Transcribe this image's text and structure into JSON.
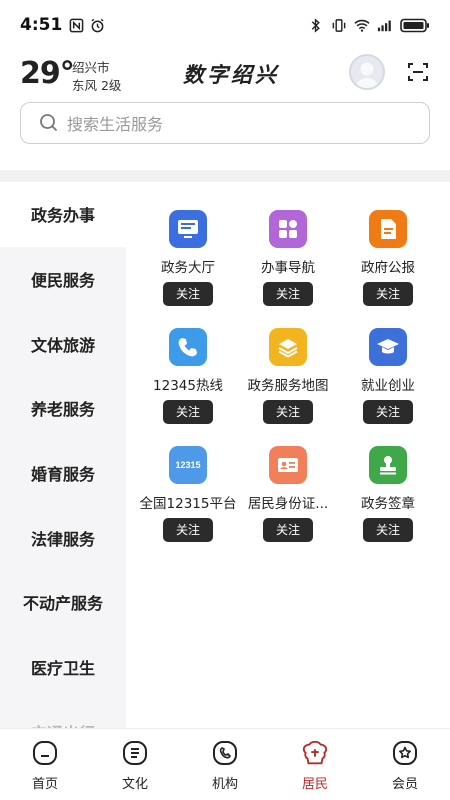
{
  "status_bar": {
    "time": "4:51",
    "icons": [
      "nfc-icon",
      "alarm-icon",
      "bluetooth-icon",
      "vibrate-icon",
      "wifi-icon",
      "signal-icon",
      "battery-icon"
    ]
  },
  "header": {
    "temperature": "29°",
    "city": "绍兴市",
    "wind": "东风 2级",
    "logo": "数字绍兴"
  },
  "search": {
    "placeholder": "搜索生活服务"
  },
  "sidebar": {
    "items": [
      {
        "label": "政务办事",
        "active": true
      },
      {
        "label": "便民服务"
      },
      {
        "label": "文体旅游"
      },
      {
        "label": "养老服务"
      },
      {
        "label": "婚育服务"
      },
      {
        "label": "法律服务"
      },
      {
        "label": "不动产服务"
      },
      {
        "label": "医疗卫生"
      },
      {
        "label": "交通出行"
      }
    ]
  },
  "services": [
    {
      "label": "政务大厅",
      "icon": "monitor-icon",
      "color": "#3b6fe0"
    },
    {
      "label": "办事导航",
      "icon": "grid-icon",
      "color": "#b267d9"
    },
    {
      "label": "政府公报",
      "icon": "document-icon",
      "color": "#f07a14"
    },
    {
      "label": "12345热线",
      "icon": "phone-icon",
      "color": "#3d9be9"
    },
    {
      "label": "政务服务地图",
      "icon": "layers-icon",
      "color": "#f3b51f"
    },
    {
      "label": "就业创业",
      "icon": "graduation-cap-icon",
      "color": "#3e70da"
    },
    {
      "label": "全国12315平台",
      "icon": "badge-12315-icon",
      "color": "#4f9ae8",
      "badge_text": "12315"
    },
    {
      "label": "居民身份证...",
      "icon": "id-card-icon",
      "color": "#f07f5a"
    },
    {
      "label": "政务签章",
      "icon": "stamp-icon",
      "color": "#3fa94a"
    }
  ],
  "follow_label": "关注",
  "bottom_nav": [
    {
      "label": "首页",
      "icon": "home-icon"
    },
    {
      "label": "文化",
      "icon": "culture-icon"
    },
    {
      "label": "机构",
      "icon": "institution-icon"
    },
    {
      "label": "居民",
      "icon": "resident-icon",
      "active": true
    },
    {
      "label": "会员",
      "icon": "member-icon"
    }
  ],
  "colors": {
    "accent": "#b32b2b",
    "follow_button": "#2b2b2b",
    "sidebar_bg": "#f5f5f7"
  }
}
